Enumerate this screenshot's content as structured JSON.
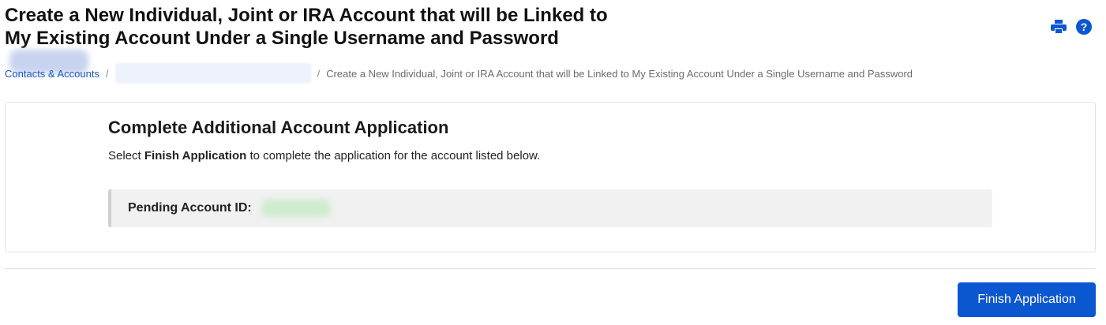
{
  "header": {
    "title": "Create a New Individual, Joint or IRA Account that will be Linked to My Existing Account Under a Single Username and Password",
    "icons": [
      "print-icon",
      "help-icon"
    ],
    "accent_color": "#0b57d0"
  },
  "breadcrumb": {
    "items": [
      {
        "label": "Contacts & Accounts",
        "link": true
      },
      {
        "label": "",
        "link": false,
        "redacted": true
      },
      {
        "label": "Create a New Individual, Joint or IRA Account that will be Linked to My Existing Account Under a Single Username and Password",
        "link": false
      }
    ]
  },
  "card": {
    "heading": "Complete Additional Account Application",
    "description_prefix": "Select ",
    "description_bold": "Finish Application",
    "description_suffix": " to complete the application for the account listed below.",
    "pending_label": "Pending Account ID:"
  },
  "footer": {
    "finish_label": "Finish Application"
  }
}
